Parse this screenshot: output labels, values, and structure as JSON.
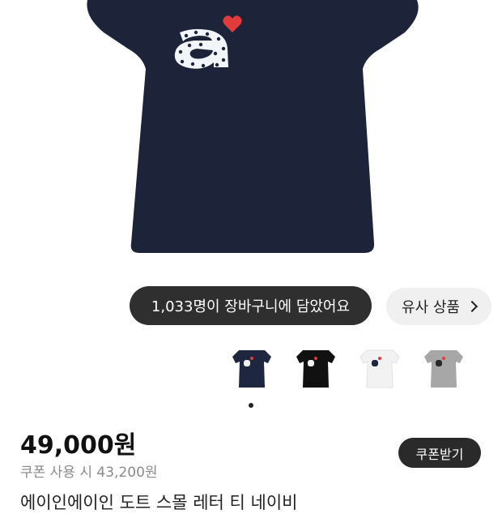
{
  "cart_badge": {
    "label": "1,033명이 장바구니에 담았어요"
  },
  "similar_button": {
    "label": "유사 상품"
  },
  "color_options": [
    {
      "name": "navy",
      "color": "#1f2640"
    },
    {
      "name": "black",
      "color": "#111111"
    },
    {
      "name": "white",
      "color": "#f2f2f2"
    },
    {
      "name": "gray",
      "color": "#a7a7a7"
    }
  ],
  "price": {
    "value": "49,000원",
    "coupon_price": "쿠폰 사용 시 43,200원"
  },
  "coupon_button": {
    "label": "쿠폰받기"
  },
  "product_title": "에이인에이인 도트 스몰 레터 티 네이비",
  "colors": {
    "shirt": "#1d2339",
    "heart": "#e23b3b",
    "dark_pill": "#2f2f2f"
  }
}
